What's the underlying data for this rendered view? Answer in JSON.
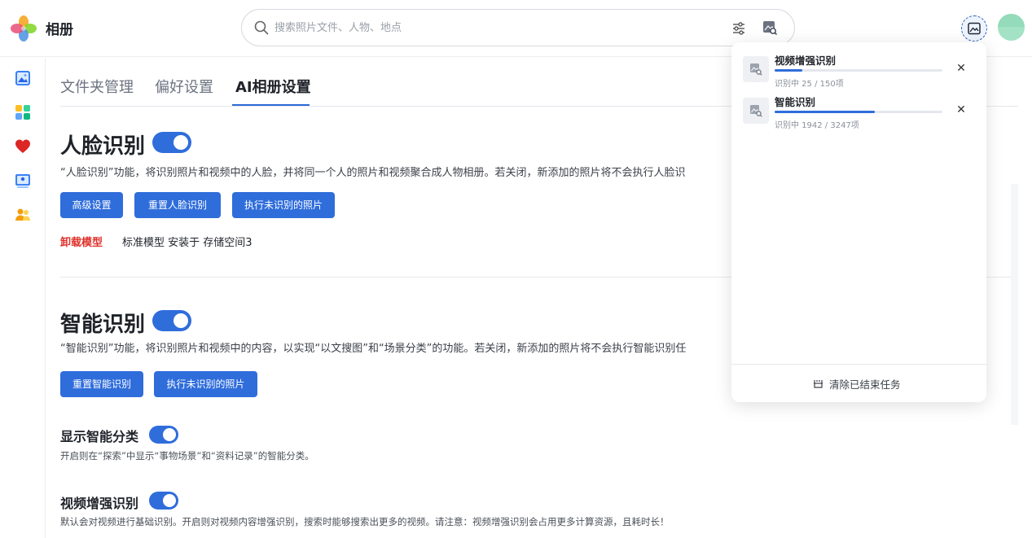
{
  "app": {
    "title": "相册"
  },
  "search": {
    "placeholder": "搜索照片文件、人物、地点"
  },
  "tabs": [
    {
      "label": "文件夹管理",
      "active": false
    },
    {
      "label": "偏好设置",
      "active": false
    },
    {
      "label": "AI相册设置",
      "active": true
    }
  ],
  "face": {
    "title": "人脸识别",
    "enabled": true,
    "description": "“人脸识别”功能，将识别照片和视频中的人脸，并将同一个人的照片和视频聚合成人物相册。若关闭，新添加的照片将不会执行人脸识",
    "buttons": [
      "高级设置",
      "重置人脸识别",
      "执行未识别的照片"
    ],
    "uninstall_label": "卸载模型",
    "model_info": "标准模型 安装于 存储空间3"
  },
  "smart": {
    "title": "智能识别",
    "enabled": true,
    "description": "“智能识别”功能，将识别照片和视频中的内容，以实现“以文搜图”和“场景分类”的功能。若关闭，新添加的照片将不会执行智能识别任",
    "buttons": [
      "重置智能识别",
      "执行未识别的照片"
    ]
  },
  "show_smart_category": {
    "title": "显示智能分类",
    "enabled": true,
    "description": "开启则在“探索”中显示“事物场景”和“资料记录”的智能分类。"
  },
  "video_enhance": {
    "title": "视频增强识别",
    "enabled": true,
    "description": "默认会对视频进行基础识别。开启则对视频内容增强识别，搜索时能够搜索出更多的视频。请注意：视频增强识别会占用更多计算资源，且耗时长！"
  },
  "tasks": {
    "items": [
      {
        "name": "视频增强识别",
        "status": "识别中 25 / 150项",
        "progress": 0.167
      },
      {
        "name": "智能识别",
        "status": "识别中 1942 / 3247项",
        "progress": 0.598
      }
    ],
    "clear_label": "清除已结束任务"
  },
  "colors": {
    "accent": "#2f6ddb",
    "danger": "#e0302a"
  }
}
